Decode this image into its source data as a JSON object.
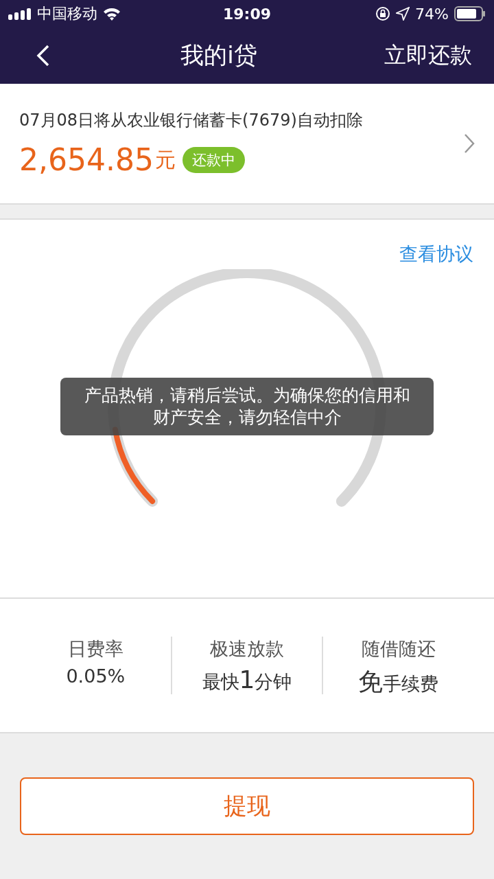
{
  "status_bar": {
    "carrier": "中国移动",
    "time": "19:09",
    "battery_text": "74%"
  },
  "nav": {
    "title": "我的i贷",
    "action": "立即还款"
  },
  "repayment": {
    "notice": "07月08日将从农业银行储蓄卡(7679)自动扣除",
    "amount": "2,654.85",
    "unit": "元",
    "status": "还款中"
  },
  "gauge": {
    "link": "查看协议",
    "level": 0.13
  },
  "features": [
    {
      "title": "日费率",
      "kind": "plain",
      "value": "0.05%"
    },
    {
      "title": "极速放款",
      "kind": "rich",
      "value": "最快",
      "highlight": "1",
      "suffix": "分钟"
    },
    {
      "title": "随借随还",
      "kind": "rich",
      "highlight": "免",
      "suffix": "手续费"
    }
  ],
  "toast": "产品热销，请稍后尝试。为确保您的信用和财产安全，请勿轻信中介",
  "button": "提现"
}
